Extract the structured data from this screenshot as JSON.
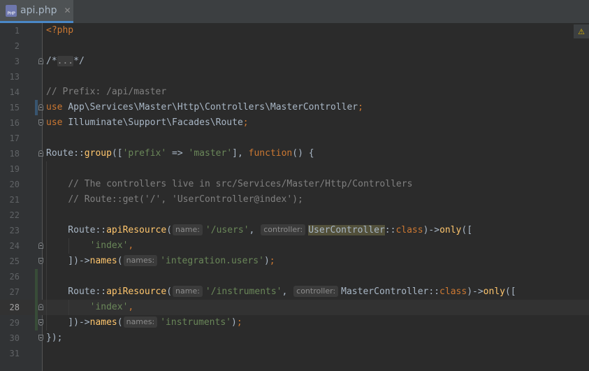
{
  "tab": {
    "filename": "api.php",
    "icon_label": "PHP",
    "close_glyph": "✕",
    "icon": "php-file-icon"
  },
  "inspection": {
    "icon": "warning-icon",
    "glyph": "⚠"
  },
  "editor": {
    "current_line": "28",
    "lines": [
      {
        "num": "1",
        "segs": [
          {
            "c": "kw",
            "t": "<?php"
          }
        ]
      },
      {
        "num": "2",
        "segs": []
      },
      {
        "num": "3",
        "segs": [
          {
            "t": "/*"
          },
          {
            "c": "folded",
            "t": "..."
          },
          {
            "t": "*/"
          }
        ]
      },
      {
        "num": "13",
        "segs": []
      },
      {
        "num": "14",
        "segs": [
          {
            "c": "cm",
            "t": "// Prefix: /api/master"
          }
        ]
      },
      {
        "num": "15",
        "segs": [
          {
            "c": "kw",
            "t": "use "
          },
          {
            "t": "App\\Services\\Master\\Http\\Controllers\\MasterController"
          },
          {
            "c": "kw",
            "t": ";"
          }
        ]
      },
      {
        "num": "16",
        "segs": [
          {
            "c": "kw",
            "t": "use "
          },
          {
            "t": "Illuminate\\Support\\Facades\\Route"
          },
          {
            "c": "kw",
            "t": ";"
          }
        ]
      },
      {
        "num": "17",
        "segs": []
      },
      {
        "num": "18",
        "segs": [
          {
            "t": "Route::"
          },
          {
            "c": "fn",
            "t": "group"
          },
          {
            "t": "(["
          },
          {
            "c": "str",
            "t": "'prefix'"
          },
          {
            "t": " => "
          },
          {
            "c": "str",
            "t": "'master'"
          },
          {
            "t": "], "
          },
          {
            "c": "kw",
            "t": "function"
          },
          {
            "t": "() {"
          }
        ]
      },
      {
        "num": "19",
        "segs": []
      },
      {
        "num": "20",
        "segs": [
          {
            "t": "    "
          },
          {
            "c": "cm",
            "t": "// The controllers live in src/Services/Master/Http/Controllers"
          }
        ]
      },
      {
        "num": "21",
        "segs": [
          {
            "t": "    "
          },
          {
            "c": "cm",
            "t": "// Route::get('/', 'UserController@index');"
          }
        ]
      },
      {
        "num": "22",
        "segs": []
      },
      {
        "num": "23",
        "segs": [
          {
            "t": "    Route::"
          },
          {
            "c": "fn",
            "t": "apiResource"
          },
          {
            "t": "("
          },
          {
            "c": "hint",
            "t": "name:"
          },
          {
            "c": "str",
            "t": "'/users'"
          },
          {
            "t": ", "
          },
          {
            "c": "hint",
            "t": "controller:"
          },
          {
            "c": "hl",
            "t": "UserController"
          },
          {
            "t": "::"
          },
          {
            "c": "kw",
            "t": "class"
          },
          {
            "t": ")->"
          },
          {
            "c": "fn",
            "t": "only"
          },
          {
            "t": "(["
          }
        ]
      },
      {
        "num": "24",
        "segs": [
          {
            "t": "        "
          },
          {
            "c": "str",
            "t": "'index'"
          },
          {
            "c": "kw",
            "t": ","
          }
        ]
      },
      {
        "num": "25",
        "segs": [
          {
            "t": "    ])->"
          },
          {
            "c": "fn",
            "t": "names"
          },
          {
            "t": "("
          },
          {
            "c": "hint",
            "t": "names:"
          },
          {
            "c": "str",
            "t": "'integration.users'"
          },
          {
            "t": ")"
          },
          {
            "c": "kw",
            "t": ";"
          }
        ]
      },
      {
        "num": "26",
        "segs": []
      },
      {
        "num": "27",
        "segs": [
          {
            "t": "    Route::"
          },
          {
            "c": "fn",
            "t": "apiResource"
          },
          {
            "t": "("
          },
          {
            "c": "hint",
            "t": "name:"
          },
          {
            "c": "str",
            "t": "'/instruments'"
          },
          {
            "t": ", "
          },
          {
            "c": "hint",
            "t": "controller:"
          },
          {
            "t": "MasterController::"
          },
          {
            "c": "kw",
            "t": "class"
          },
          {
            "t": ")->"
          },
          {
            "c": "fn",
            "t": "only"
          },
          {
            "t": "(["
          }
        ]
      },
      {
        "num": "28",
        "segs": [
          {
            "t": "        "
          },
          {
            "c": "str",
            "t": "'index'"
          },
          {
            "c": "kw",
            "t": ","
          }
        ]
      },
      {
        "num": "29",
        "segs": [
          {
            "t": "    ])->"
          },
          {
            "c": "fn",
            "t": "names"
          },
          {
            "t": "("
          },
          {
            "c": "hint",
            "t": "names:"
          },
          {
            "c": "str",
            "t": "'instruments'"
          },
          {
            "t": ")"
          },
          {
            "c": "kw",
            "t": ";"
          }
        ]
      },
      {
        "num": "30",
        "segs": [
          {
            "t": "});"
          }
        ]
      },
      {
        "num": "31",
        "segs": []
      }
    ]
  },
  "colors": {
    "background": "#2b2b2b",
    "gutter": "#313335",
    "keyword": "#cc7832",
    "string": "#6a8759",
    "comment": "#808080",
    "function": "#ffc66d",
    "text": "#a9b7c6",
    "tab_underline": "#4a88c7"
  }
}
